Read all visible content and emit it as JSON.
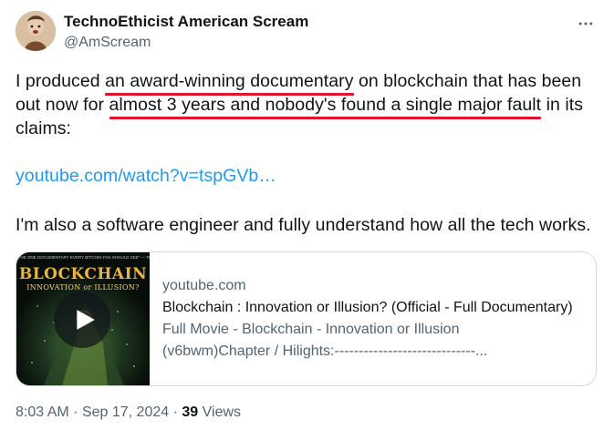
{
  "author": {
    "display_name": "TechnoEthicist American Scream",
    "handle": "@AmScream"
  },
  "tweet": {
    "line1": {
      "before": "I produced ",
      "underlined": "an award-winning documentary",
      "after": " on blockchain that has been"
    },
    "line2": {
      "before": "out now for ",
      "underlined": "almost 3 years and nobody's found a single major fault",
      "after": " in its"
    },
    "line3": "claims:",
    "link_text": "youtube.com/watch?v=tspGVb…",
    "line7": "I'm also a software engineer and fully understand how all the tech works."
  },
  "card": {
    "thumbnail": {
      "tagline": "\"THE ONE DOCUMENTARY EVERY BITCOIN FAN SHOULD SEE\" — THE GUARDIAN",
      "title": "BLOCKCHAIN",
      "subtitle": "INNOVATION or ILLUSION?"
    },
    "domain": "youtube.com",
    "title": "Blockchain : Innovation or Illusion? (Official - Full Documentary)",
    "description_line1": "Full Movie - Blockchain - Innovation or Illusion",
    "description_line2": "(v6bwm)Chapter / Hilights:-----------------------------..."
  },
  "meta": {
    "time": "8:03 AM",
    "separator": "·",
    "date": "Sep 17, 2024",
    "views_count": "39",
    "views_label": "Views"
  },
  "colors": {
    "text": "#0f1419",
    "secondary": "#536471",
    "link": "#1d9bf0",
    "highlight_underline": "#e8112d",
    "border": "#cfd9de"
  },
  "icons": {
    "more": "more-horizontal-icon",
    "play": "play-icon"
  }
}
